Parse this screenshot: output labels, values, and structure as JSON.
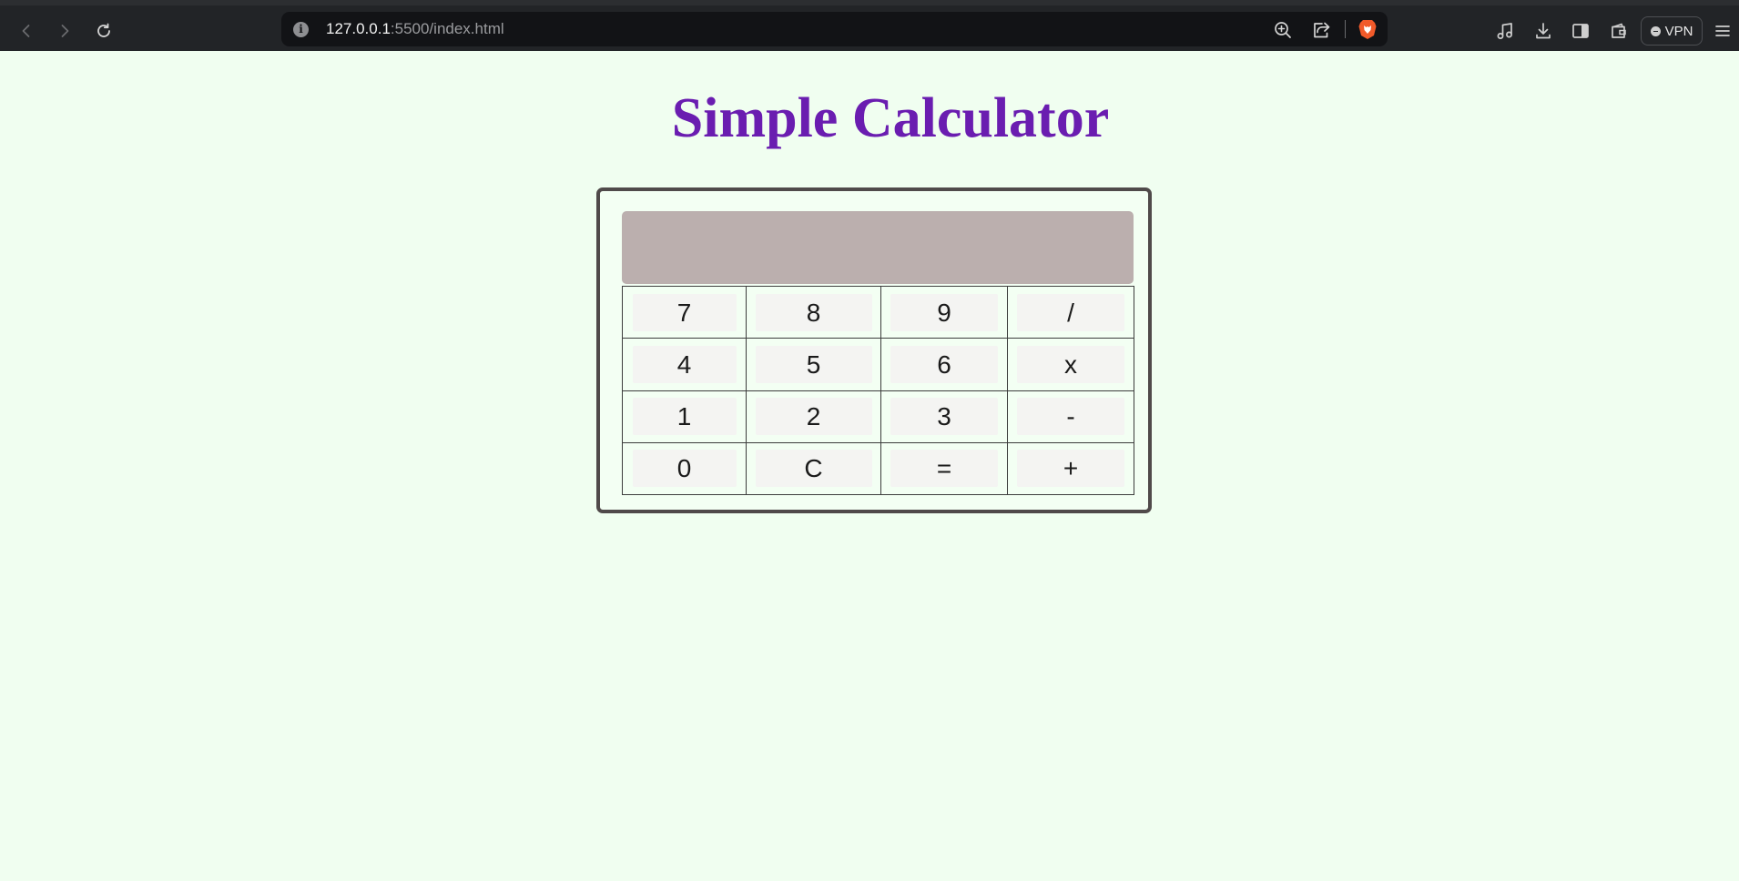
{
  "browser": {
    "url_host": "127.0.0.1",
    "url_path": ":5500/index.html",
    "vpn_label": "VPN",
    "icons": {
      "back": "back-arrow-icon",
      "forward": "forward-arrow-icon",
      "reload": "reload-icon",
      "site_info": "info-icon",
      "zoom": "zoom-in-icon",
      "share": "share-icon",
      "brave": "brave-shields-icon",
      "media": "music-note-icon",
      "downloads": "download-icon",
      "sidebar": "sidebar-icon",
      "wallet": "wallet-icon",
      "menu": "hamburger-menu-icon"
    }
  },
  "page": {
    "title": "Simple Calculator",
    "title_color": "#6a1db0",
    "background_color": "#f0fef0"
  },
  "calculator": {
    "display_value": "",
    "display_color": "#bbafae",
    "keys": [
      [
        "7",
        "8",
        "9",
        "/"
      ],
      [
        "4",
        "5",
        "6",
        "x"
      ],
      [
        "1",
        "2",
        "3",
        "-"
      ],
      [
        "0",
        "C",
        "=",
        "+"
      ]
    ]
  }
}
